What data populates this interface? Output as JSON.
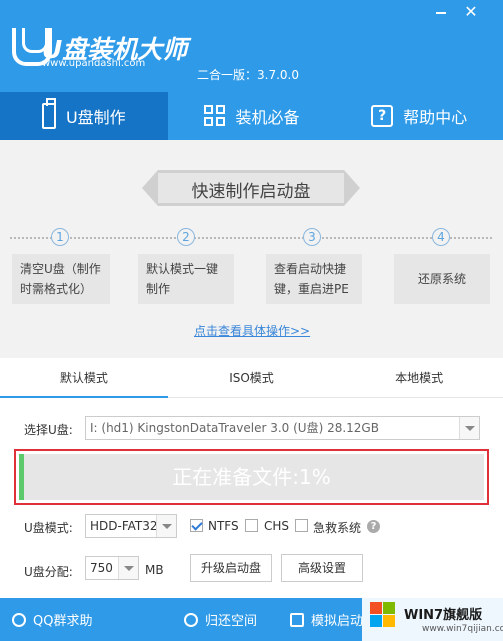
{
  "app": {
    "logo_title": "U盘装机大师",
    "logo_url": "www.upandashi.com",
    "version": "二合一版：3.7.0.0"
  },
  "nav": {
    "items": [
      {
        "label": "U盘制作",
        "icon": "usb-icon"
      },
      {
        "label": "装机必备",
        "icon": "grid-icon"
      },
      {
        "label": "帮助中心",
        "icon": "help-icon"
      }
    ]
  },
  "panel": {
    "banner": "快速制作启动盘",
    "steps": [
      {
        "num": "1",
        "text": "清空U盘（制作时需格式化）"
      },
      {
        "num": "2",
        "text": "默认模式一键制作"
      },
      {
        "num": "3",
        "text": "查看启动快捷键，重启进PE"
      },
      {
        "num": "4",
        "text": "还原系统"
      }
    ],
    "detail_link": "点击查看具体操作>>"
  },
  "tabs": [
    "默认模式",
    "ISO模式",
    "本地模式"
  ],
  "form": {
    "select_u_label": "选择U盘:",
    "select_u_value": "I: (hd1) KingstonDataTraveler 3.0 (U盘) 28.12GB",
    "progress_text": "正在准备文件:1%",
    "progress_value": 0.01,
    "mode_label": "U盘模式:",
    "mode_value": "HDD-FAT32",
    "ntfs_label": "NTFS",
    "chs_label": "CHS",
    "rescue_label": "急救系统",
    "partition_label": "U盘分配:",
    "partition_value": "750",
    "partition_unit": "MB",
    "upgrade_button": "升级启动盘",
    "advanced_button": "高级设置"
  },
  "footer": {
    "qq": "QQ群求助",
    "restore": "归还空间",
    "simulate": "模拟启动"
  },
  "watermark": {
    "title": "WIN7旗舰版",
    "url": "www.win7qijian.com"
  },
  "colors": {
    "brand_blue": "#2e9ae8",
    "nav_active": "#1674c7",
    "progress_green": "#5cc96b",
    "highlight_red": "#e0303a"
  }
}
